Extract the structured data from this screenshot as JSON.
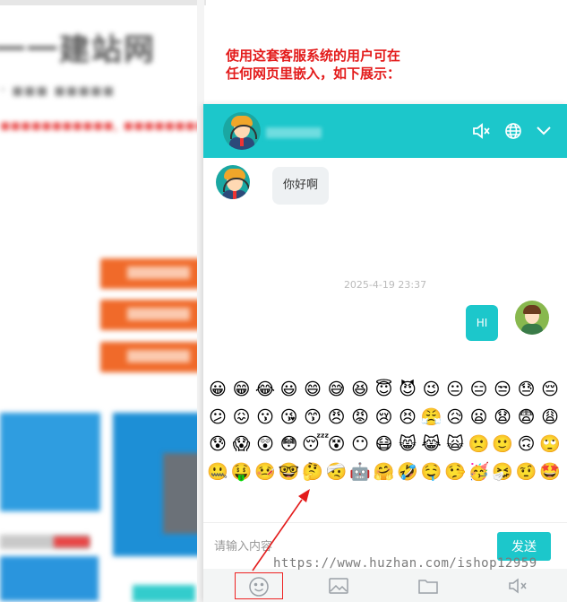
{
  "annotation": {
    "line1": "使用这套客服系统的用户可在",
    "line2": "任何网页里嵌入，如下展示："
  },
  "chat": {
    "header": {
      "icons": [
        "speaker-mute-icon",
        "globe-icon",
        "chevron-down-icon"
      ]
    },
    "messages": {
      "incoming_text": "你好啊",
      "timestamp": "2025-4-19 23:37",
      "outgoing_text": "HI"
    },
    "emojis": [
      "😀",
      "😁",
      "😂",
      "😃",
      "😄",
      "😅",
      "😆",
      "😇",
      "😈",
      "😉",
      "😐",
      "😑",
      "😒",
      "😓",
      "😔",
      "😕",
      "😖",
      "😗",
      "😘",
      "😙",
      "😠",
      "😡",
      "😢",
      "😣",
      "😤",
      "😥",
      "😦",
      "😧",
      "😨",
      "😩",
      "😰",
      "😱",
      "😲",
      "😳",
      "😴",
      "😵",
      "😶",
      "😷",
      "😸",
      "😹",
      "🙀",
      "🙁",
      "🙂",
      "🙃",
      "🙄",
      "🤐",
      "🤑",
      "🤒",
      "🤓",
      "🤔",
      "🤕",
      "🤖",
      "🤗",
      "🤣",
      "🤤",
      "🤥",
      "🥳",
      "🤧",
      "🤨",
      "🤩"
    ],
    "input": {
      "placeholder": "请输入内容",
      "value": ""
    },
    "send_label": "发送",
    "toolbar": [
      "emoji-icon",
      "image-icon",
      "folder-icon",
      "sound-mute-icon"
    ],
    "colors": {
      "accent": "#1cc7cb",
      "annotation_red": "#e31b1b"
    }
  },
  "watermark": "https://www.huzhan.com/ishop12959"
}
